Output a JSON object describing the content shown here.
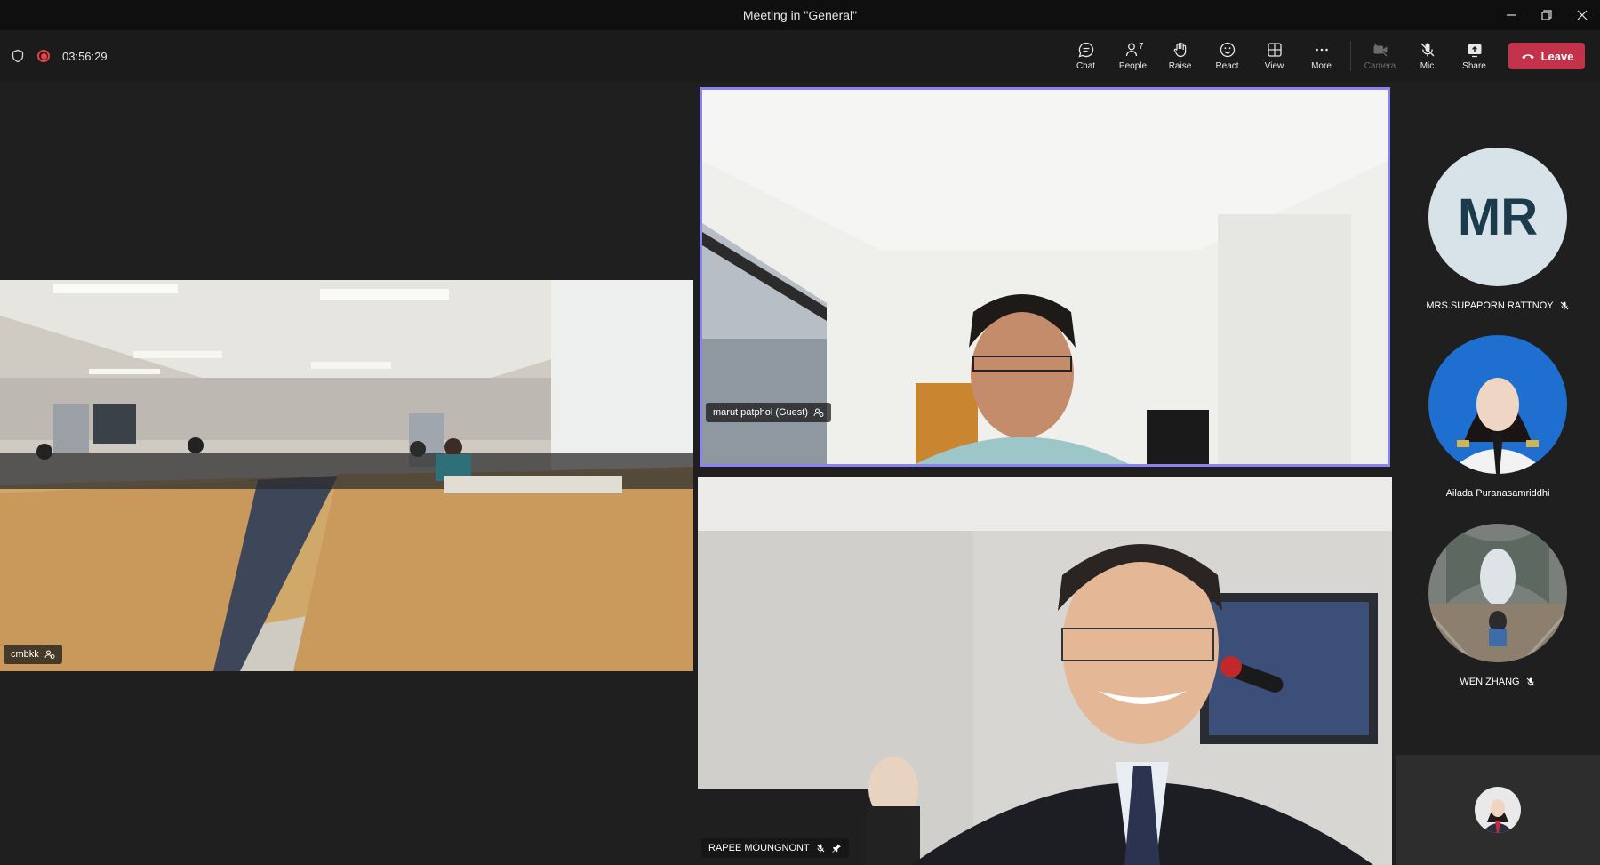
{
  "window": {
    "title": "Meeting in \"General\""
  },
  "toolbar": {
    "timer": "03:56:29",
    "buttons": {
      "chat": "Chat",
      "people": "People",
      "people_count": "7",
      "raise": "Raise",
      "react": "React",
      "view": "View",
      "more": "More",
      "camera": "Camera",
      "mic": "Mic",
      "share": "Share"
    },
    "leave_label": "Leave",
    "leave_color": "#c4314b"
  },
  "stage": {
    "tiles": {
      "room": {
        "label": "cmbkk"
      },
      "marut": {
        "label": "marut patphol (Guest)",
        "highlight_color": "#8a84f0"
      },
      "rapee": {
        "label": "RAPEE MOUNGNONT"
      }
    }
  },
  "sidebar": {
    "participants": [
      {
        "name": "MRS.SUPAPORN RATTNOY",
        "initials": "MR",
        "muted": true
      },
      {
        "name": "Ailada Puranasamriddhi",
        "muted": false
      },
      {
        "name": "WEN ZHANG",
        "muted": true
      }
    ]
  },
  "icons": {
    "shield": "shield-icon",
    "record": "recording-icon",
    "chat": "chat-icon",
    "people": "people-icon",
    "raise": "raise-hand-icon",
    "react": "smiley-icon",
    "view": "view-grid-icon",
    "more": "more-icon",
    "camera": "camera-off-icon",
    "mic": "mic-off-icon",
    "share": "share-icon",
    "leave": "phone-hangup-icon"
  }
}
